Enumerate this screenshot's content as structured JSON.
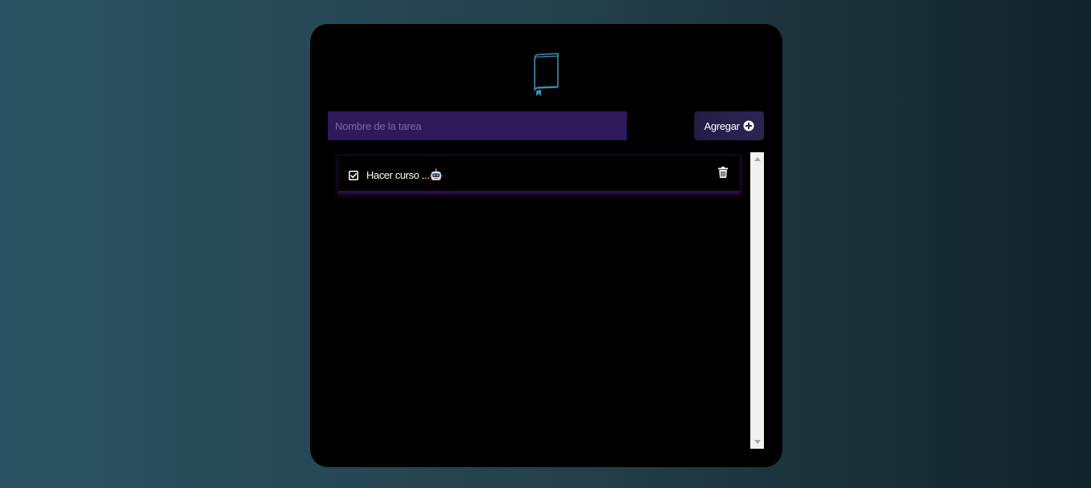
{
  "form": {
    "input_placeholder": "Nombre de la tarea",
    "input_value": "",
    "add_button_label": "Agregar"
  },
  "tasks": [
    {
      "text": "Hacer curso ...",
      "emoji_icon": "robot-face-icon",
      "completed": true
    }
  ],
  "icons": {
    "logo": "book-bookmark-icon",
    "add": "circle-plus-icon",
    "check": "checkbox-checked-icon",
    "delete": "trash-icon"
  },
  "colors": {
    "card_background": "#000000",
    "input_background": "#2e1a5a",
    "button_background": "#2a2450",
    "logo_stroke": "#3a8fb7",
    "task_shadow": "#2a0d3d"
  }
}
